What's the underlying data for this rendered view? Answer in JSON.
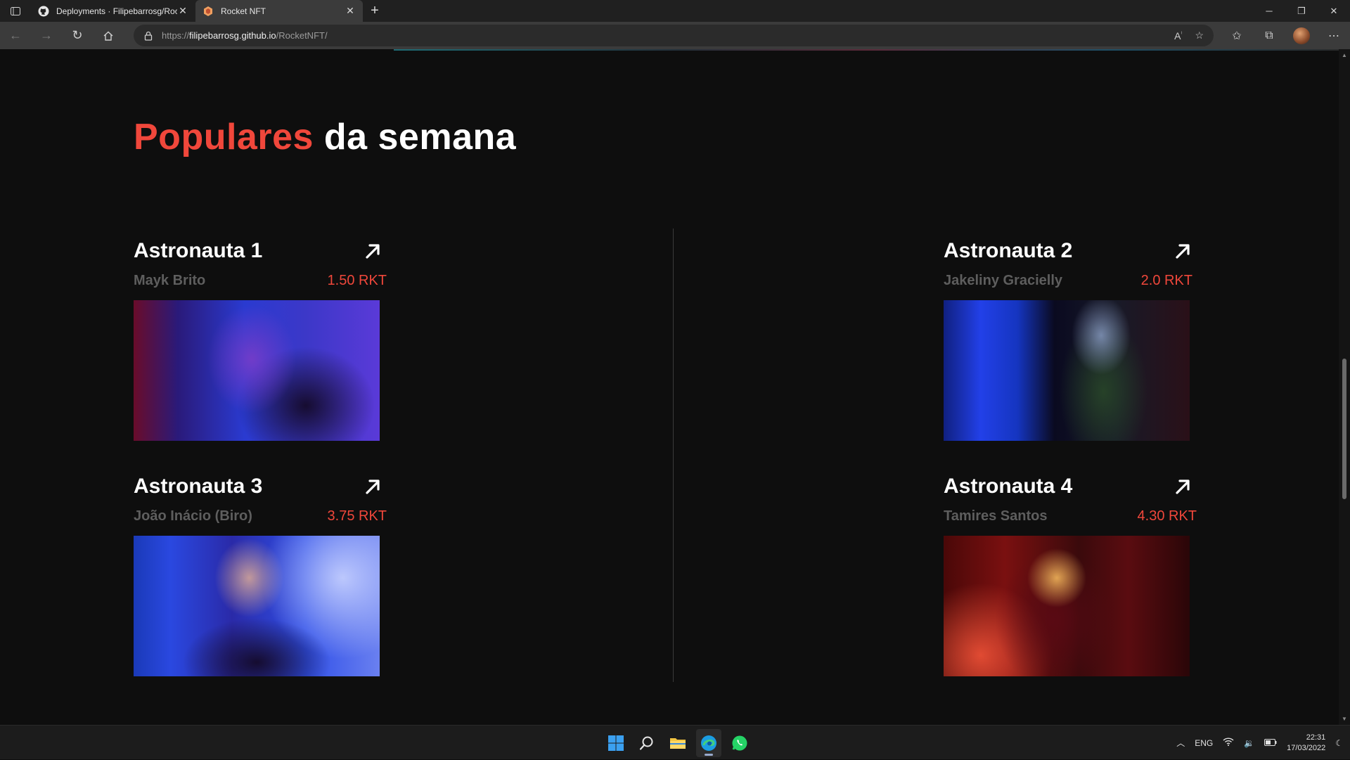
{
  "browser": {
    "tabs": [
      {
        "title": "Deployments · Filipebarrosg/Roc",
        "active": false,
        "icon": "github-icon"
      },
      {
        "title": "Rocket NFT",
        "active": true,
        "icon": "rocket-nft-icon"
      }
    ],
    "url": {
      "scheme": "https://",
      "host": "filipebarrosg.github.io",
      "path": "/RocketNFT/"
    }
  },
  "page": {
    "title_accent": "Populares",
    "title_rest": " da semana",
    "cards": [
      {
        "name": "Astronauta 1",
        "author": "Mayk Brito",
        "price": "1.50 RKT"
      },
      {
        "name": "Astronauta 2",
        "author": "Jakeliny Gracielly",
        "price": "2.0 RKT"
      },
      {
        "name": "Astronauta 3",
        "author": "João Inácio (Biro)",
        "price": "3.75 RKT"
      },
      {
        "name": "Astronauta 4",
        "author": "Tamires Santos",
        "price": "4.30 RKT"
      }
    ],
    "colors": {
      "accent": "#f0473b",
      "background": "#0e0e0e",
      "author": "#5e5e5e"
    }
  },
  "taskbar": {
    "apps": [
      "windows-start-icon",
      "search-icon",
      "file-explorer-icon",
      "edge-icon",
      "whatsapp-icon"
    ],
    "language": "ENG",
    "time": "22:31",
    "date": "17/03/2022"
  }
}
